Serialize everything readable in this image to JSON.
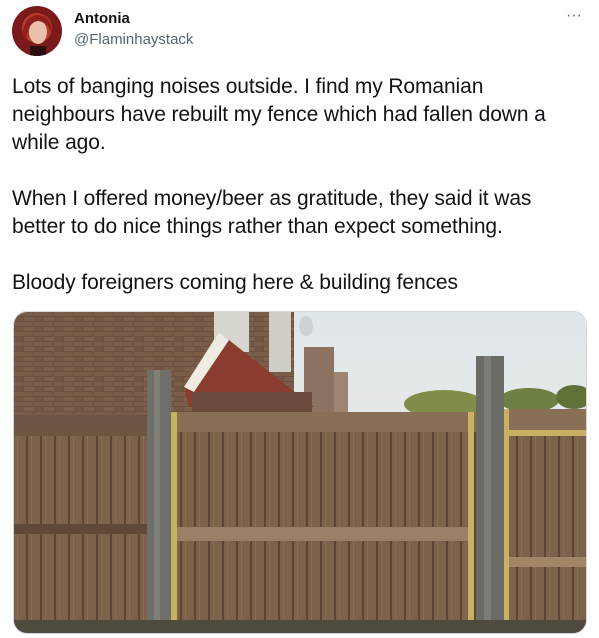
{
  "author": {
    "display_name": "Antonia",
    "handle": "@Flaminhaystack"
  },
  "more_icon": "more-horizontal-icon",
  "tweet": {
    "paragraphs": [
      "Lots of banging noises outside. I find my Romanian neighbours have rebuilt my fence which had fallen down a while ago.",
      "When I offered money/beer as gratitude, they said it was better to do nice things rather than expect something.",
      "Bloody foreigners coming here & building fences"
    ]
  },
  "colors": {
    "text": "#0f1419",
    "secondary": "#536471",
    "border": "#cfd9de"
  }
}
